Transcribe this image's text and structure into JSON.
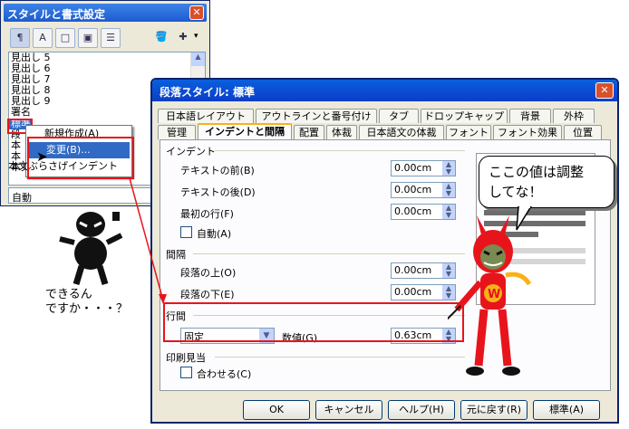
{
  "stylist": {
    "title": "スタイルと書式設定",
    "close": "✕",
    "toolbar": [
      "¶",
      "A",
      "□",
      "▣",
      "☰",
      "▾"
    ],
    "items": [
      "見出し 5",
      "見出し 6",
      "見出し 7",
      "見出し 8",
      "見出し 9",
      "署名",
      "標準",
      "段",
      "本",
      "本",
      "本文"
    ],
    "filter": "自動"
  },
  "context_menu": {
    "items": [
      "新規作成(A)",
      "変更(B)..."
    ],
    "hidden_item": "本文ぶらさげインデント"
  },
  "dialog": {
    "title": "段落スタイル: 標準",
    "close": "✕",
    "tabs_row1": [
      "日本語レイアウト",
      "アウトラインと番号付け",
      "タブ",
      "ドロップキャップ",
      "背景",
      "外枠"
    ],
    "tabs_row2": [
      "管理",
      "インデントと間隔",
      "配置",
      "体裁",
      "日本語文の体裁",
      "フォント",
      "フォント効果",
      "位置"
    ],
    "indent": {
      "header": "インデント",
      "before_label": "テキストの前(B)",
      "before_value": "0.00cm",
      "after_label": "テキストの後(D)",
      "after_value": "0.00cm",
      "first_label": "最初の行(F)",
      "first_value": "0.00cm",
      "auto_label": "自動(A)"
    },
    "spacing": {
      "header": "間隔",
      "above_label": "段落の上(O)",
      "above_value": "0.00cm",
      "below_label": "段落の下(E)",
      "below_value": "0.00cm"
    },
    "linespacing": {
      "header": "行間",
      "mode": "固定",
      "value_label": "数値(G)",
      "value": "0.63cm"
    },
    "register": {
      "header": "印刷見当",
      "label": "合わせる(C)"
    },
    "buttons": {
      "ok": "OK",
      "cancel": "キャンセル",
      "help": "ヘルプ(H)",
      "reset": "元に戻す(R)",
      "standard": "標準(A)"
    }
  },
  "annotations": {
    "question": "できるん\nですか・・・？",
    "bubble": "ここの値は調整\nしてな！"
  },
  "colors": {
    "highlight": "#e8141c",
    "accent": "#f9b119",
    "titlebar": "#0b4fd6"
  }
}
